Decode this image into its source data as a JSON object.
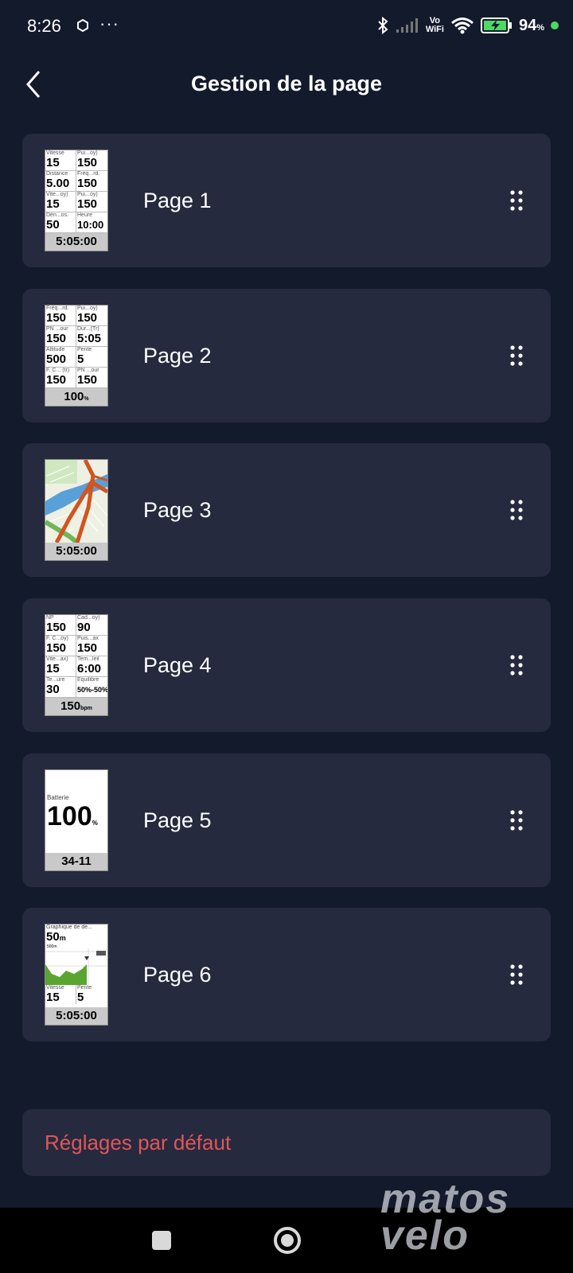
{
  "status_bar": {
    "time": "8:26",
    "more": "···",
    "vowifi_top": "Vo",
    "vowifi_bottom": "WiFi",
    "battery_pct": "94",
    "battery_unit": "%"
  },
  "header": {
    "title": "Gestion de la page"
  },
  "pages": [
    {
      "label": "Page 1",
      "cells": [
        {
          "label": "Vitesse",
          "value": "15"
        },
        {
          "label": "Pui...oy)",
          "value": "150"
        },
        {
          "label": "Distance",
          "value": "5.00"
        },
        {
          "label": "Fréq...rd.",
          "value": "150"
        },
        {
          "label": "Vite...oy)",
          "value": "15"
        },
        {
          "label": "Pui...oy)",
          "value": "150"
        },
        {
          "label": "Dén...os.",
          "value": "50"
        },
        {
          "label": "Heure",
          "value": "10:00"
        }
      ],
      "footer": "5:05:00",
      "footer_unit": ""
    },
    {
      "label": "Page 2",
      "cells": [
        {
          "label": "Fréq...rd.",
          "value": "150"
        },
        {
          "label": "Pui...oy)",
          "value": "150"
        },
        {
          "label": "PN ...our",
          "value": "150"
        },
        {
          "label": "Dur...(Tr)",
          "value": "5:05"
        },
        {
          "label": "Altitude",
          "value": "500"
        },
        {
          "label": "Pente",
          "value": "5"
        },
        {
          "label": "F. C... (tr)",
          "value": "150"
        },
        {
          "label": "PN ...our",
          "value": "150"
        }
      ],
      "footer": "100",
      "footer_unit": "%"
    },
    {
      "label": "Page 3",
      "footer": "5:05:00"
    },
    {
      "label": "Page 4",
      "cells": [
        {
          "label": "NP",
          "value": "150"
        },
        {
          "label": "Cad...oy)",
          "value": "90"
        },
        {
          "label": "F. C...oy)",
          "value": "150"
        },
        {
          "label": "Puis...ax",
          "value": "150"
        },
        {
          "label": "Vite...ax)",
          "value": "15"
        },
        {
          "label": "Tem...leil",
          "value": "6:00"
        },
        {
          "label": "Te...ure",
          "value": "30"
        },
        {
          "label": "Équilibre",
          "value": "50%-50%"
        }
      ],
      "footer": "150",
      "footer_unit": "bpm"
    },
    {
      "label": "Page 5",
      "battery_label": "Batterie",
      "battery_value": "100",
      "battery_unit": "%",
      "footer": "34-11"
    },
    {
      "label": "Page 6",
      "graph_label": "Graphique de dé...",
      "graph_value": "50",
      "graph_unit": "m",
      "graph_scale": "500m",
      "cells": [
        {
          "label": "Vitesse",
          "value": "15"
        },
        {
          "label": "Pente",
          "value": "5"
        }
      ],
      "footer": "5:05:00"
    }
  ],
  "defaults": {
    "label": "Réglages par défaut"
  },
  "watermark": {
    "line1": "matos",
    "line2": "velo"
  },
  "colors": {
    "background": "#131a2c",
    "card": "#252a3e",
    "danger_text": "#e0565b",
    "thumb_footer": "#c9c9c9",
    "map_road": "#d2541e",
    "map_water": "#5aa0d8",
    "graph_fill": "#5aa531"
  }
}
